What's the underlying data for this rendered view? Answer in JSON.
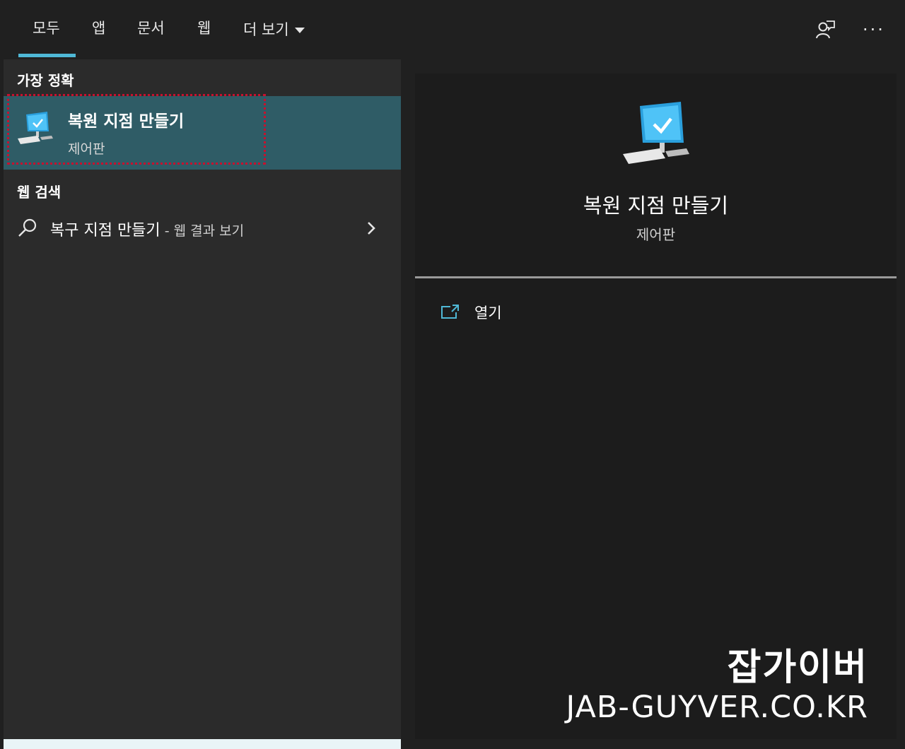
{
  "tabs": [
    {
      "label": "모두",
      "active": true
    },
    {
      "label": "앱"
    },
    {
      "label": "문서"
    },
    {
      "label": "웹"
    },
    {
      "label": "더 보기"
    }
  ],
  "top_icons": {
    "feedback": "feedback-person-icon",
    "more": "···"
  },
  "left": {
    "best_match_heading": "가장 정확",
    "best_match": {
      "title": "복원 지점 만들기",
      "subtitle": "제어판",
      "icon": "monitor-check-icon"
    },
    "web_heading": "웹 검색",
    "web_result": {
      "query": "복구 지점 만들기",
      "suffix": " - 웹 결과 보기"
    }
  },
  "preview": {
    "title": "복원 지점 만들기",
    "subtitle": "제어판",
    "actions": [
      {
        "label": "열기",
        "icon": "open-external-icon"
      }
    ]
  },
  "watermark": {
    "ko": "잡가이버",
    "en": "JAB-GUYVER.CO.KR"
  },
  "colors": {
    "accent": "#4fb8d6",
    "selected_bg": "#2f5c66",
    "highlight_border": "#c8102e"
  }
}
